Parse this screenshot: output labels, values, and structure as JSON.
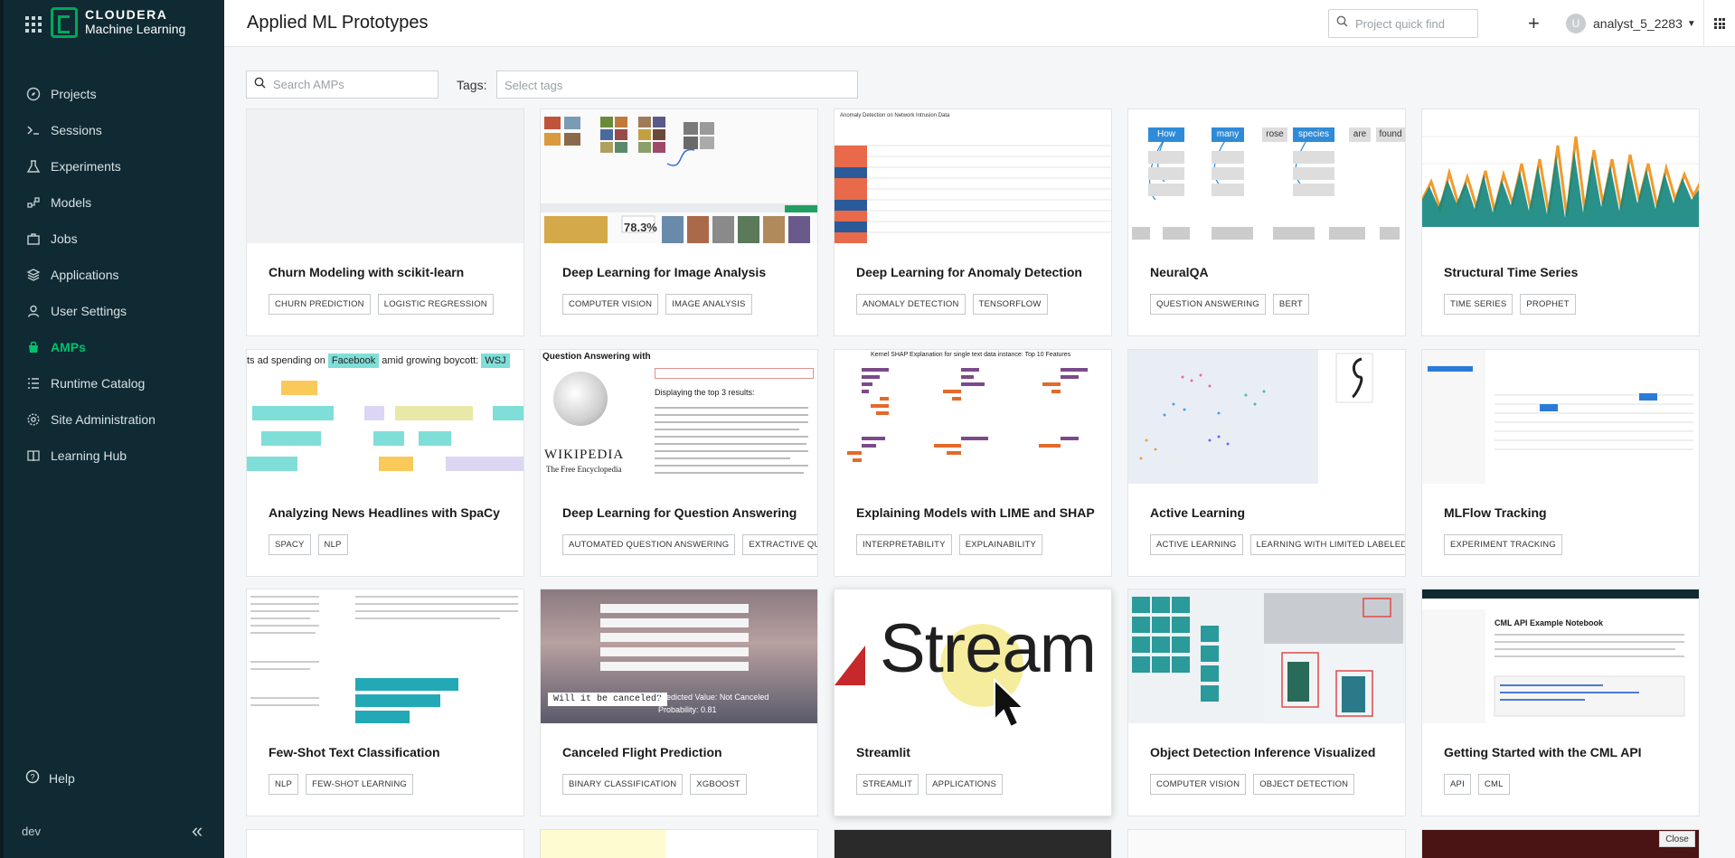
{
  "sidebar": {
    "brand_line1": "CLOUDERA",
    "brand_line2": "Machine Learning",
    "items": [
      {
        "label": "Projects",
        "icon": "compass-icon"
      },
      {
        "label": "Sessions",
        "icon": "terminal-icon"
      },
      {
        "label": "Experiments",
        "icon": "flask-icon"
      },
      {
        "label": "Models",
        "icon": "nodes-icon"
      },
      {
        "label": "Jobs",
        "icon": "briefcase-icon"
      },
      {
        "label": "Applications",
        "icon": "layers-icon"
      },
      {
        "label": "User Settings",
        "icon": "person-icon"
      },
      {
        "label": "AMPs",
        "icon": "amp-bag-icon"
      },
      {
        "label": "Runtime Catalog",
        "icon": "list-icon"
      },
      {
        "label": "Site Administration",
        "icon": "gear-icon"
      },
      {
        "label": "Learning Hub",
        "icon": "book-icon"
      }
    ],
    "active_item": "AMPs",
    "help_label": "Help",
    "env_label": "dev"
  },
  "header": {
    "title": "Applied ML Prototypes",
    "quick_find_placeholder": "Project quick find",
    "avatar_letter": "U",
    "username": "analyst_5_2283"
  },
  "filters": {
    "search_placeholder": "Search AMPs",
    "tags_label": "Tags:",
    "tags_placeholder": "Select tags"
  },
  "amps": [
    {
      "name": "Churn Modeling with scikit-learn",
      "tags": [
        "CHURN PREDICTION",
        "LOGISTIC REGRESSION"
      ]
    },
    {
      "name": "Deep Learning for Image Analysis",
      "tags": [
        "COMPUTER VISION",
        "IMAGE ANALYSIS"
      ]
    },
    {
      "name": "Deep Learning for Anomaly Detection",
      "tags": [
        "ANOMALY DETECTION",
        "TENSORFLOW"
      ]
    },
    {
      "name": "NeuralQA",
      "tags": [
        "QUESTION ANSWERING",
        "BERT"
      ]
    },
    {
      "name": "Structural Time Series",
      "tags": [
        "TIME SERIES",
        "PROPHET"
      ]
    },
    {
      "name": "Analyzing News Headlines with SpaCy",
      "tags": [
        "SPACY",
        "NLP"
      ]
    },
    {
      "name": "Deep Learning for Question Answering",
      "tags": [
        "AUTOMATED QUESTION ANSWERING",
        "EXTRACTIVE QUESTI"
      ]
    },
    {
      "name": "Explaining Models with LIME and SHAP",
      "tags": [
        "INTERPRETABILITY",
        "EXPLAINABILITY"
      ]
    },
    {
      "name": "Active Learning",
      "tags": [
        "ACTIVE LEARNING",
        "LEARNING WITH LIMITED LABELED DAT"
      ]
    },
    {
      "name": "MLFlow Tracking",
      "tags": [
        "EXPERIMENT TRACKING"
      ]
    },
    {
      "name": "Few-Shot Text Classification",
      "tags": [
        "NLP",
        "FEW-SHOT LEARNING"
      ]
    },
    {
      "name": "Canceled Flight Prediction",
      "tags": [
        "BINARY CLASSIFICATION",
        "XGBOOST"
      ]
    },
    {
      "name": "Streamlit",
      "tags": [
        "STREAMLIT",
        "APPLICATIONS"
      ]
    },
    {
      "name": "Object Detection Inference Visualized",
      "tags": [
        "COMPUTER VISION",
        "OBJECT DETECTION"
      ]
    },
    {
      "name": "Getting Started with the CML API",
      "tags": [
        "API",
        "CML"
      ]
    }
  ],
  "thumb_text": {
    "image_pct": "78.3%",
    "wiki_title": "WIKIPEDIA",
    "wiki_sub": "The Free Encyclopedia",
    "qa_header": "Question Answering with",
    "qa_results": "Displaying the top 3 results:",
    "news_line1_a": "ts ad spending on",
    "news_line1_ent": "Facebook",
    "news_line1_b": "amid growing boycott:",
    "news_line1_ent2": "WSJ",
    "flight_question": "Will it be canceled?",
    "flight_pred": "Predicted Value: Not Canceled",
    "flight_prob": "Probability: 0.81",
    "streamlit_word": "Stream",
    "neuralqa_words": [
      "How",
      "many",
      "rose",
      "species",
      "are",
      "found"
    ],
    "api_notebook": "CML API Example Notebook",
    "shap_title": "Kernel SHAP Explanation for single text data instance: Top 10 Features",
    "anomaly_title": "Anomaly Detection on Network Intrusion Data"
  },
  "close_label": "Close",
  "colors": {
    "sidebar_bg": "#0f2a33",
    "active_green": "#00c16e",
    "brand_green": "#00a85a"
  }
}
